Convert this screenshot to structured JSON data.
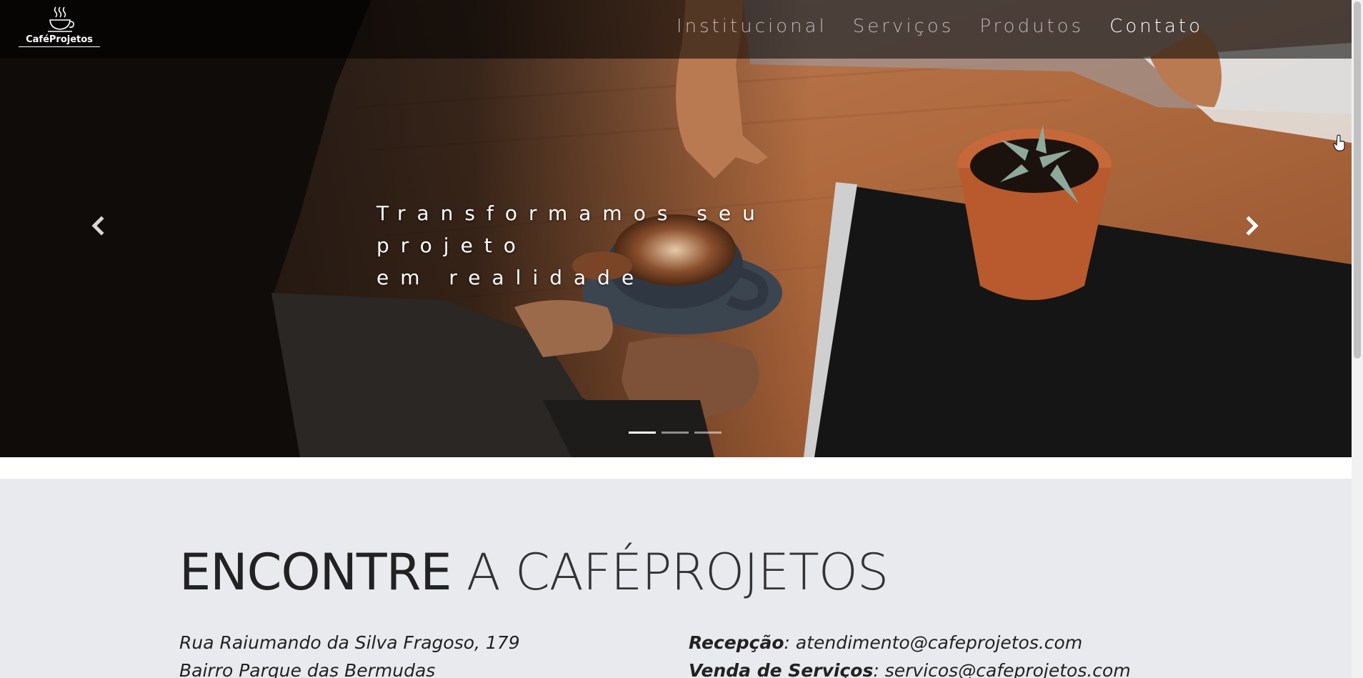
{
  "brand": {
    "name": "CaféProjetos",
    "icon": "coffee-cup-icon"
  },
  "nav": {
    "items": [
      {
        "label": "Institucional",
        "active": false
      },
      {
        "label": "Serviços",
        "active": false
      },
      {
        "label": "Produtos",
        "active": false
      },
      {
        "label": "Contato",
        "active": true
      }
    ]
  },
  "hero": {
    "caption_line1": "Transformamos seu projeto",
    "caption_line2": "em realidade",
    "prev_icon": "chevron-left-icon",
    "next_icon": "chevron-right-icon",
    "indicators_active": 1,
    "indicators_count": 3
  },
  "contact": {
    "title_strong": "ENCONTRE",
    "title_light": "A CAFÉPROJETOS",
    "address_line1": "Rua Raiumando da Silva Fragoso, 179",
    "address_line2": "Bairro Parque das Bermudas",
    "email1_label": "Recepção",
    "email1_value": ": atendimento@cafeprojetos.com",
    "email2_label": "Venda de Serviços",
    "email2_value": ": servicos@cafeprojetos.com"
  },
  "colors": {
    "navbar_bg": "#000000",
    "section_bg": "#e9eaee",
    "text_dark": "#222222",
    "wood": "#b06a3e"
  }
}
